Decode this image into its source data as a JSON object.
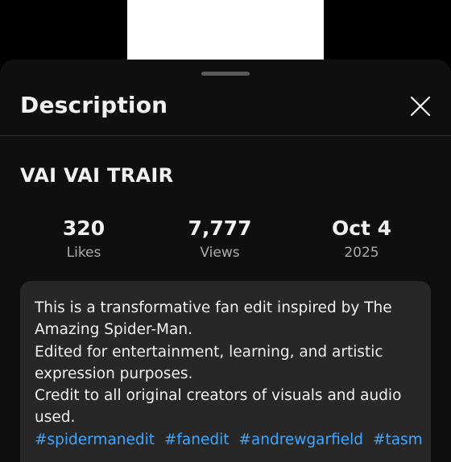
{
  "sheet": {
    "title": "Description"
  },
  "video": {
    "title": "VAI VAI TRAIR"
  },
  "stats": {
    "likes": {
      "value": "320",
      "label": "Likes"
    },
    "views": {
      "value": "7,777",
      "label": "Views"
    },
    "date": {
      "value": "Oct 4",
      "label": "2025"
    }
  },
  "description": {
    "text": "This is a transformative fan edit inspired by The Amazing Spider-Man.\nEdited for entertainment, learning, and artistic expression purposes.\nCredit to all original creators of visuals and audio used.",
    "hashtags": [
      "#spidermanedit",
      "#fanedit",
      "#andrewgarfield",
      "#tasm"
    ]
  },
  "icons": {
    "close": "close-icon"
  },
  "colors": {
    "background": "#000000",
    "sheet": "#0f0f0f",
    "card": "#272727",
    "text_primary": "#f1f1f1",
    "text_secondary": "#aaaaaa",
    "link": "#3ea6ff"
  }
}
